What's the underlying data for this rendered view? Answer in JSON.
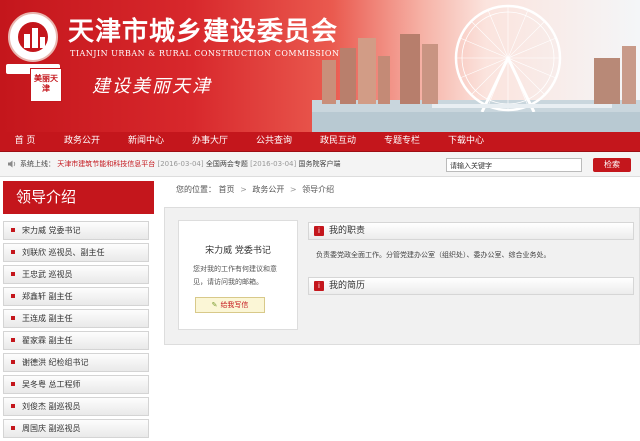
{
  "header": {
    "title_cn": "天津市城乡建设委员会",
    "title_en": "TIANJIN URBAN & RURAL CONSTRUCTION COMMISSION",
    "slogan": "建设美丽天津",
    "seal_text": "美丽天津"
  },
  "nav": {
    "items": [
      "首 页",
      "政务公开",
      "新闻中心",
      "办事大厅",
      "公共查询",
      "政民互动",
      "专题专栏",
      "下载中心"
    ]
  },
  "notice": {
    "prefix": "系统上线：",
    "items": [
      {
        "text": "天津市建筑节能和科技信息平台",
        "date": "[2016-03-04]"
      },
      {
        "text": "全国两会专题",
        "date": "[2016-03-04]"
      },
      {
        "text": "国务院客户端",
        "date": ""
      }
    ]
  },
  "search": {
    "placeholder": "请输入关键字",
    "button": "检索"
  },
  "sidebar": {
    "title": "领导介绍",
    "items": [
      "宋力威  党委书记",
      "刘联欣  巡视员、副主任",
      "王忠武  巡视员",
      "郑鑫轩  副主任",
      "王连成  副主任",
      "翟家霖  副主任",
      "谢德洪  纪检组书记",
      "吴冬粤  总工程师",
      "刘俊杰  副巡视员",
      "周国庆  副巡视员"
    ]
  },
  "breadcrumb": {
    "label": "您的位置：",
    "items": [
      "首页",
      "政务公开",
      "领导介绍"
    ],
    "sep": ">"
  },
  "profile": {
    "name": "宋力威  党委书记",
    "desc": "您对我的工作有何建议和意见，请访问我的邮箱。",
    "write_btn": "给我写信"
  },
  "sections": {
    "duty_title": "我的职责",
    "duty_text": "负责委党政全面工作。分管党建办公室（组织处）、委办公室、综合业务处。",
    "resume_title": "我的简历"
  },
  "colors": {
    "brand_red": "#c4161c"
  }
}
